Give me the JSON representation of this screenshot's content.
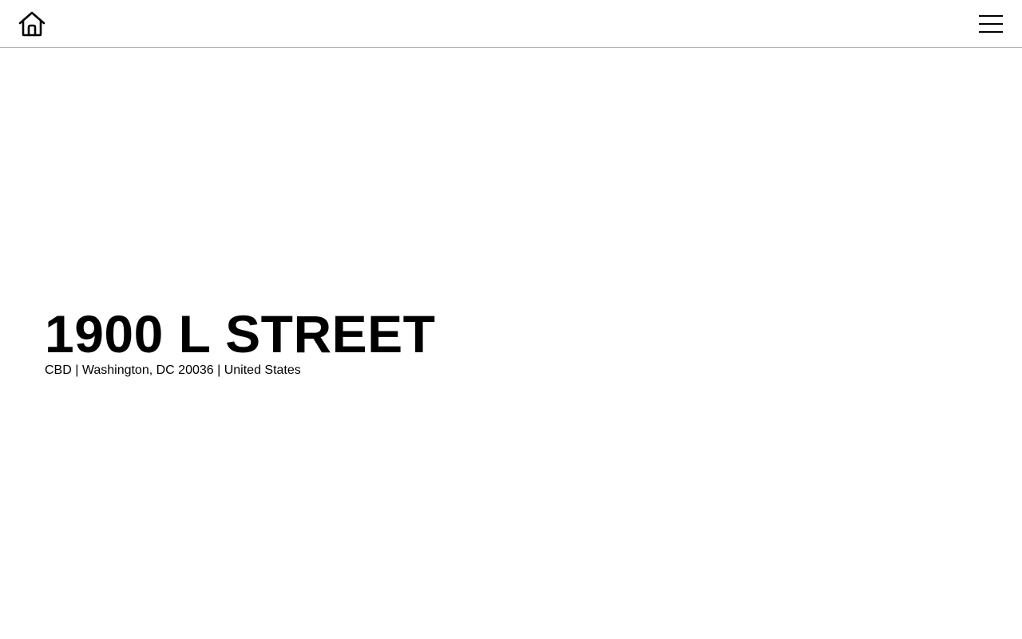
{
  "header": {
    "home_icon": "home-icon",
    "menu_icon": "hamburger-menu-icon"
  },
  "hero": {
    "title": "1900 L STREET",
    "subtitle": "CBD | Washington, DC 20036 | United States"
  },
  "colors": {
    "background": "#ffffff",
    "text": "#000000",
    "header_border": "#b3b3b3"
  }
}
